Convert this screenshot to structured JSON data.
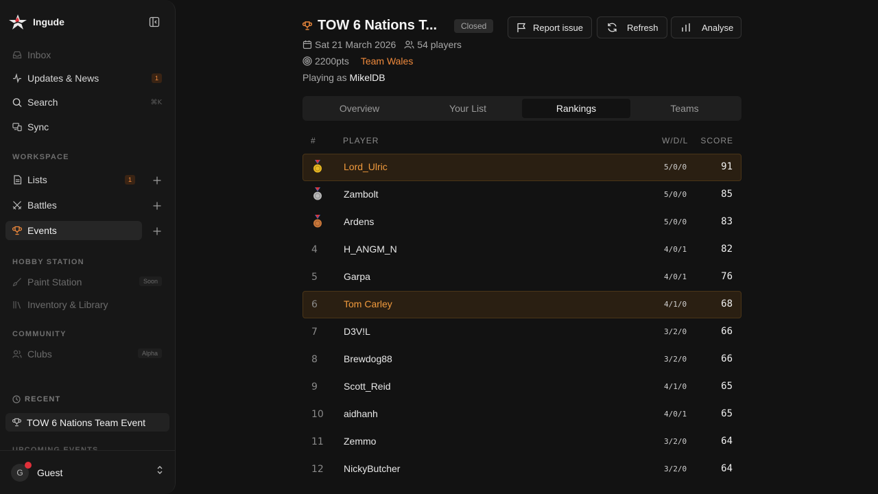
{
  "app": {
    "name": "Ingude"
  },
  "sidebar": {
    "nav": [
      {
        "label": "Inbox",
        "icon": "inbox-icon",
        "state": "dim"
      },
      {
        "label": "Updates & News",
        "icon": "activity-icon",
        "badge": "1"
      },
      {
        "label": "Search",
        "icon": "search-icon",
        "shortcut": "⌘K"
      },
      {
        "label": "Sync",
        "icon": "sync-icon"
      }
    ],
    "workspace_label": "WORKSPACE",
    "workspace": [
      {
        "label": "Lists",
        "icon": "list-icon",
        "badge": "1"
      },
      {
        "label": "Battles",
        "icon": "swords-icon"
      },
      {
        "label": "Events",
        "icon": "trophy-icon",
        "active": true
      }
    ],
    "hobby_label": "HOBBY STATION",
    "hobby": [
      {
        "label": "Paint Station",
        "icon": "brush-icon",
        "tag": "Soon"
      },
      {
        "label": "Inventory & Library",
        "icon": "library-icon"
      }
    ],
    "community_label": "COMMUNITY",
    "community": [
      {
        "label": "Clubs",
        "icon": "users-icon",
        "tag": "Alpha"
      }
    ],
    "recent_label": "RECENT",
    "recent_item": "TOW 6 Nations Team Event",
    "upcoming_label": "UPCOMING EVENTS",
    "user": {
      "initial": "G",
      "name": "Guest"
    }
  },
  "event": {
    "title": "TOW 6 Nations T...",
    "status": "Closed",
    "date": "Sat 21 March 2026",
    "players": "54 players",
    "points": "2200pts",
    "team": "Team Wales",
    "playing_as_prefix": "Playing as",
    "playing_as_name": "MikelDB"
  },
  "toolbar": {
    "report": "Report issue",
    "refresh": "Refresh",
    "analyse": "Analyse"
  },
  "tabs": [
    "Overview",
    "Your List",
    "Rankings",
    "Teams"
  ],
  "active_tab": "Rankings",
  "table": {
    "headers": {
      "rank": "#",
      "player": "PLAYER",
      "wdl": "W/D/L",
      "score": "SCORE"
    },
    "rows": [
      {
        "rank": "1",
        "medal": "gold",
        "player": "Lord_Ulric",
        "wdl": "5/0/0",
        "score": "91",
        "highlight": true
      },
      {
        "rank": "2",
        "medal": "silver",
        "player": "Zambolt",
        "wdl": "5/0/0",
        "score": "85"
      },
      {
        "rank": "3",
        "medal": "bronze",
        "player": "Ardens",
        "wdl": "5/0/0",
        "score": "83"
      },
      {
        "rank": "4",
        "player": "H_ANGM_N",
        "wdl": "4/0/1",
        "score": "82"
      },
      {
        "rank": "5",
        "player": "Garpa",
        "wdl": "4/0/1",
        "score": "76"
      },
      {
        "rank": "6",
        "player": "Tom Carley",
        "wdl": "4/1/0",
        "score": "68",
        "highlight": true
      },
      {
        "rank": "7",
        "player": "D3V!L",
        "wdl": "3/2/0",
        "score": "66"
      },
      {
        "rank": "8",
        "player": "Brewdog88",
        "wdl": "3/2/0",
        "score": "66"
      },
      {
        "rank": "9",
        "player": "Scott_Reid",
        "wdl": "4/1/0",
        "score": "65"
      },
      {
        "rank": "10",
        "player": "aidhanh",
        "wdl": "4/0/1",
        "score": "65"
      },
      {
        "rank": "11",
        "player": "Zemmo",
        "wdl": "3/2/0",
        "score": "64"
      },
      {
        "rank": "12",
        "player": "NickyButcher",
        "wdl": "3/2/0",
        "score": "64"
      }
    ]
  },
  "colors": {
    "accent": "#f08a3c",
    "highlight_bg": "#2a1f12",
    "gold": "#e9b823",
    "silver": "#b8b8b8",
    "bronze": "#c9773a"
  }
}
